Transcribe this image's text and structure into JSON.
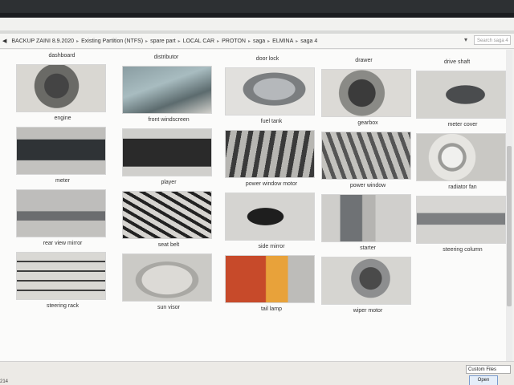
{
  "window": {
    "breadcrumbs": [
      "BACKUP ZAINI 8.9.2020",
      "Existing Partition (NTFS)",
      "spare part",
      "LOCAL CAR",
      "PROTON",
      "saga",
      "ELMINA",
      "saga 4"
    ],
    "search_placeholder": "Search saga 4"
  },
  "top_row_labels": [
    "dashboard",
    "distributor",
    "door lock",
    "drawer",
    "drive shaft"
  ],
  "tiles": [
    {
      "label": "engine",
      "icon": "photo-engine"
    },
    {
      "label": "front windscreen",
      "icon": "photo-windscreen"
    },
    {
      "label": "fuel tank",
      "icon": "photo-fuel-tank"
    },
    {
      "label": "gearbox",
      "icon": "photo-gearbox"
    },
    {
      "label": "meter cover",
      "icon": "photo-meter-cover"
    },
    {
      "label": "meter",
      "icon": "photo-meter"
    },
    {
      "label": "player",
      "icon": "photo-player"
    },
    {
      "label": "power window motor",
      "icon": "photo-power-window-motor"
    },
    {
      "label": "power window",
      "icon": "photo-power-window"
    },
    {
      "label": "radiator fan",
      "icon": "photo-radiator-fan"
    },
    {
      "label": "rear view mirror",
      "icon": "photo-rear-view-mirror"
    },
    {
      "label": "seat belt",
      "icon": "photo-seat-belt"
    },
    {
      "label": "side mirror",
      "icon": "photo-side-mirror"
    },
    {
      "label": "starter",
      "icon": "photo-starter"
    },
    {
      "label": "steering column",
      "icon": "photo-steering-column"
    },
    {
      "label": "steering rack",
      "icon": "photo-steering-rack"
    },
    {
      "label": "sun visor",
      "icon": "photo-sun-visor"
    },
    {
      "label": "tail lamp",
      "icon": "photo-tail-lamp"
    },
    {
      "label": "wiper motor",
      "icon": "photo-wiper-motor"
    }
  ],
  "footer": {
    "file_type": "Custom Files",
    "open_button": "Open",
    "file_name_fragment": "214"
  }
}
